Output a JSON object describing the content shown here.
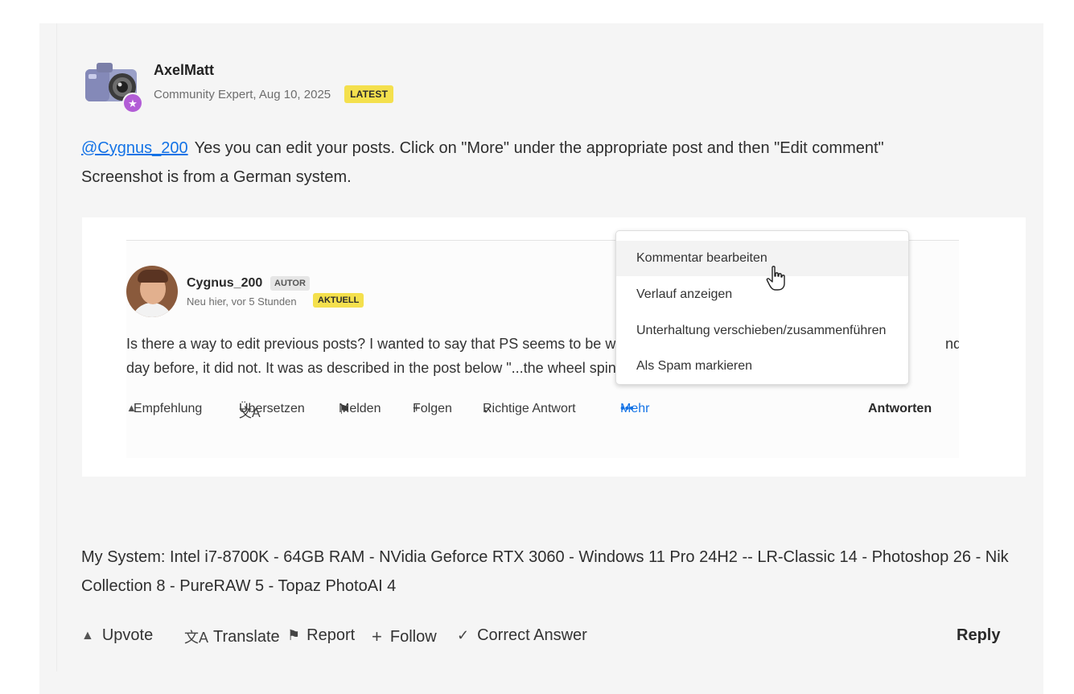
{
  "post": {
    "author": "AxelMatt",
    "role_date": "Community Expert, Aug 10, 2025",
    "badge": "LATEST",
    "mention": "@Cygnus_200",
    "text_line1": "Yes you can edit your posts. Click on \"More\" under the appropriate post and then \"Edit comment\"",
    "text_line2": "Screenshot is from a German system.",
    "signature": "My System: Intel i7-8700K - 64GB RAM - NVidia Geforce RTX 3060 - Windows 11 Pro 24H2 -- LR-Classic 14 - Photoshop 26 - Nik Collection 8 - PureRAW 5 - Topaz PhotoAI 4"
  },
  "screenshot": {
    "author": "Cygnus_200",
    "author_badge": "AUTOR",
    "meta": "Neu hier, vor 5 Stunden",
    "badge": "AKTUELL",
    "line1_start": "Is there a way to edit previous posts? I wanted to say that PS seems to be wo",
    "line1_end": "nd the",
    "line2": "day before, it did not. It was as described in the post below \"...the wheel spin",
    "actions": {
      "upvote": "Empfehlung",
      "translate": "Übersetzen",
      "report": "Melden",
      "follow": "Folgen",
      "correct": "Richtige Antwort",
      "more": "Mehr",
      "reply": "Antworten"
    },
    "menu": [
      "Kommentar bearbeiten",
      "Verlauf anzeigen",
      "Unterhaltung verschieben/zusammenführen",
      "Als Spam markieren"
    ]
  },
  "actions": {
    "upvote": "Upvote",
    "translate": "Translate",
    "report": "Report",
    "follow": "Follow",
    "correct": "Correct Answer",
    "reply": "Reply"
  },
  "colors": {
    "card_bg": "#f5f5f5",
    "link": "#1473e6",
    "badge_yellow": "#f4e04d",
    "expert_purple": "#b25dd6"
  },
  "icons": [
    "camera-avatar-icon",
    "star-badge-icon",
    "upvote-triangle-icon",
    "translate-icon",
    "flag-icon",
    "plus-icon",
    "checkmark-icon",
    "more-dots-icon",
    "hand-cursor-icon"
  ]
}
